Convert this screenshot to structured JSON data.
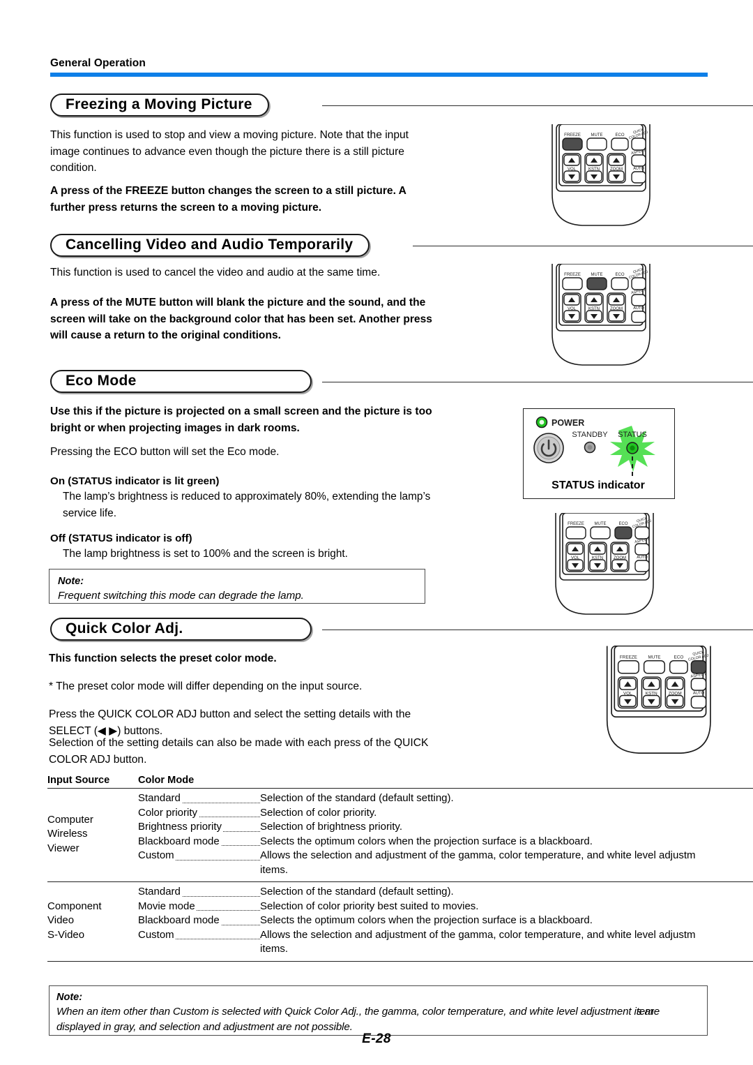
{
  "header": {
    "running_title": "General Operation",
    "rule_color": "#0e7fe8"
  },
  "sections": [
    {
      "id": "freeze",
      "title": "Freezing a Moving Picture",
      "paragraphs": [
        "This function is used to stop and view a moving picture. Note that the input image continues to advance even though the picture there is a still picture condition.",
        "A press of the FREEZE button changes the screen to a still picture. A further press returns the screen to a moving picture."
      ]
    },
    {
      "id": "mute",
      "title": "Cancelling Video and Audio Temporarily",
      "paragraphs": [
        "This function is used to cancel the video and audio at the same time.",
        "A press of the MUTE button will blank the picture and the sound, and the screen will take on the background color that has been set. Another press will cause a return to the original conditions."
      ]
    },
    {
      "id": "eco",
      "title": "Eco Mode",
      "lead": "Use this if the picture is projected on a small screen and the picture is too bright or when projecting images in dark rooms.",
      "paragraphs": [
        "Pressing the ECO button will set the Eco mode."
      ],
      "items": [
        {
          "heading": "On (STATUS indicator is lit green)",
          "body": "The lamp’s brightness is reduced to approximately 80%, extending the lamp’s service life."
        },
        {
          "heading": "Off (STATUS indicator is off)",
          "body": "The lamp brightness is set to 100% and the screen is bright."
        }
      ],
      "note": {
        "label": "Note:",
        "body": "Frequent switching this mode can degrade the lamp."
      }
    },
    {
      "id": "quickcolor",
      "title": "Quick Color Adj.",
      "lead": "This function selects the preset color mode.",
      "paragraphs": [
        "* The preset color mode will differ depending on the input source.",
        "Press the QUICK COLOR ADJ button and select the setting details with the SELECT (◀ ▶) buttons.",
        "Selection of the setting details can also be made with each press of the QUICK COLOR ADJ button."
      ],
      "note": {
        "label": "Note:",
        "body_line1": "When an item other than Custom is selected with Quick Color Adj., the gamma, color temperature, and white level adjustment item",
        "body_line1_overlap": "s are",
        "body_line2": "displayed in gray, and selection and adjustment are not possible."
      }
    }
  ],
  "table": {
    "columns": [
      "Input Source",
      "Color Mode"
    ],
    "groups": [
      {
        "sources": [
          "Computer",
          "Wireless",
          "Viewer"
        ],
        "rows": [
          {
            "mode": "Standard",
            "desc": "Selection of the standard (default setting)."
          },
          {
            "mode": "Color priority",
            "desc": "Selection of color priority."
          },
          {
            "mode": "Brightness priority",
            "desc": "Selection of brightness priority."
          },
          {
            "mode": "Blackboard mode",
            "desc": "Selects the optimum colors when the projection surface is a blackboard."
          },
          {
            "mode": "Custom",
            "desc": "Allows the selection and adjustment of the gamma, color temperature, and white level adjustm"
          }
        ],
        "continuation": "items."
      },
      {
        "sources": [
          "Component",
          "Video",
          "S-Video"
        ],
        "rows": [
          {
            "mode": "Standard",
            "desc": "Selection of the standard (default setting)."
          },
          {
            "mode": "Movie mode",
            "desc": "Selection of color priority best suited to movies."
          },
          {
            "mode": "Blackboard mode",
            "desc": "Selects the optimum colors when the projection surface is a blackboard."
          },
          {
            "mode": "Custom",
            "desc": "Allows the selection and adjustment of the gamma, color temperature, and white level adjustm"
          }
        ],
        "continuation": "items."
      }
    ]
  },
  "remotes": [
    {
      "id": "remote-freeze",
      "highlight": "FREEZE"
    },
    {
      "id": "remote-mute",
      "highlight": "MUTE"
    },
    {
      "id": "remote-eco",
      "highlight": "ECO"
    },
    {
      "id": "remote-quickcolor",
      "highlight": "QUICK COLOR ADJ"
    }
  ],
  "remote_labels": {
    "freeze": "FREEZE",
    "mute": "MUTE",
    "eco": "ECO",
    "quick_color_adj_l1": "QUICK",
    "quick_color_adj_l2": "COLOR ADJ",
    "aspect": "ASPECT",
    "vol": "VOL",
    "kstn": "KSTN",
    "zoom": "ZOOM",
    "auto": "AUTO"
  },
  "status_panel": {
    "power_label": "POWER",
    "standby_label": "STANDBY",
    "status_label": "STATUS",
    "caption": "STATUS indicator",
    "led_green": "#21c521",
    "glow_green": "#55e055"
  },
  "footer": {
    "page_number": "E-28"
  }
}
